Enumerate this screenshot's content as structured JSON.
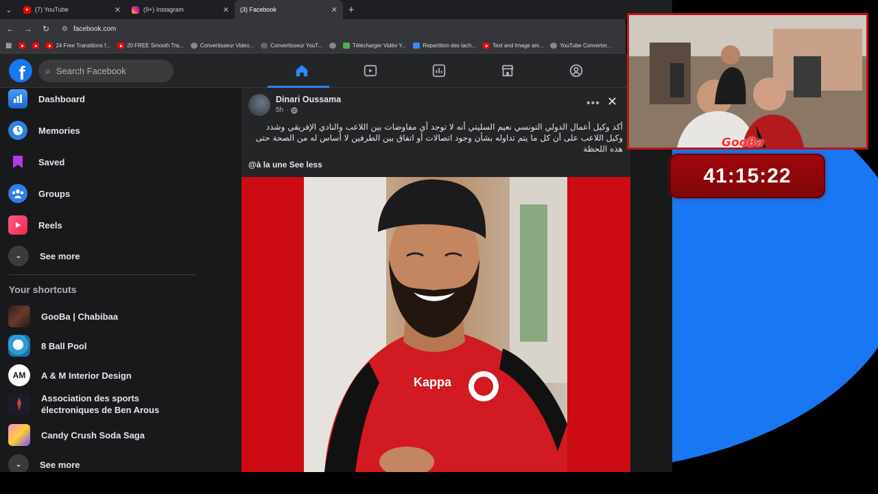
{
  "browser": {
    "tabs": [
      {
        "title": "(7) YouTube",
        "favicon": "youtube-icon",
        "active": false
      },
      {
        "title": "(9+) Instagram",
        "favicon": "instagram-icon",
        "active": false
      },
      {
        "title": "(3) Facebook",
        "favicon": "facebook-icon",
        "active": true
      }
    ],
    "new_tab": "+",
    "url": "facebook.com",
    "bookmarks": [
      {
        "label": "",
        "icon": "youtube-icon"
      },
      {
        "label": "",
        "icon": "youtube-icon"
      },
      {
        "label": "24 Free Transitions f...",
        "icon": "youtube-icon"
      },
      {
        "label": "20 FREE Smooth Tra...",
        "icon": "youtube-icon"
      },
      {
        "label": "Convertisseur Video...",
        "icon": "globe-icon"
      },
      {
        "label": "Convertisseur YouT...",
        "icon": "globe-icon"
      },
      {
        "label": "",
        "icon": "globe-icon"
      },
      {
        "label": "Télécharger Vidéo Y...",
        "icon": "download-icon"
      },
      {
        "label": "Repartition des tach...",
        "icon": "doc-icon"
      },
      {
        "label": "Text and Image ani...",
        "icon": "youtube-icon"
      },
      {
        "label": "YouTube Converter...",
        "icon": "globe-icon"
      }
    ]
  },
  "facebook": {
    "search_placeholder": "Search Facebook",
    "sidebar": {
      "items": [
        {
          "label": "Dashboard",
          "icon": "dashboard-icon"
        },
        {
          "label": "Memories",
          "icon": "memories-icon"
        },
        {
          "label": "Saved",
          "icon": "saved-icon"
        },
        {
          "label": "Groups",
          "icon": "groups-icon"
        },
        {
          "label": "Reels",
          "icon": "reels-icon"
        }
      ],
      "see_more": "See more",
      "shortcuts_heading": "Your shortcuts",
      "shortcuts": [
        {
          "label": "GooBa | Chabibaa"
        },
        {
          "label": "8 Ball Pool"
        },
        {
          "label": "A & M Interior Design"
        },
        {
          "label": "Association des sports électroniques de Ben Arous"
        },
        {
          "label": "Candy Crush Soda Saga"
        }
      ],
      "see_more_2": "See more"
    },
    "post": {
      "author": "Dinari Oussama",
      "time": "5h",
      "text": "أكد وكيل أعمال الدولي التونسي نعيم السليتي أنه لا توجد أي مفاوضات بين اللاعب والنادي الإفريقي وشدد وكيل اللاعب على أن كل ما يتم تداوله بشأن وجود اتصالات أو اتفاق بين الطرفين لا أساس له من الصحة حتى هذه اللحظة",
      "tagline": "@à la une See less"
    }
  },
  "overlay": {
    "timer": "41:15:22",
    "channel_name": "GooBa"
  },
  "colors": {
    "fb_blue": "#1877f2",
    "active_underline": "#2d88ff",
    "post_bg_red": "#cc0b12",
    "timer_red": "#a0070c"
  }
}
